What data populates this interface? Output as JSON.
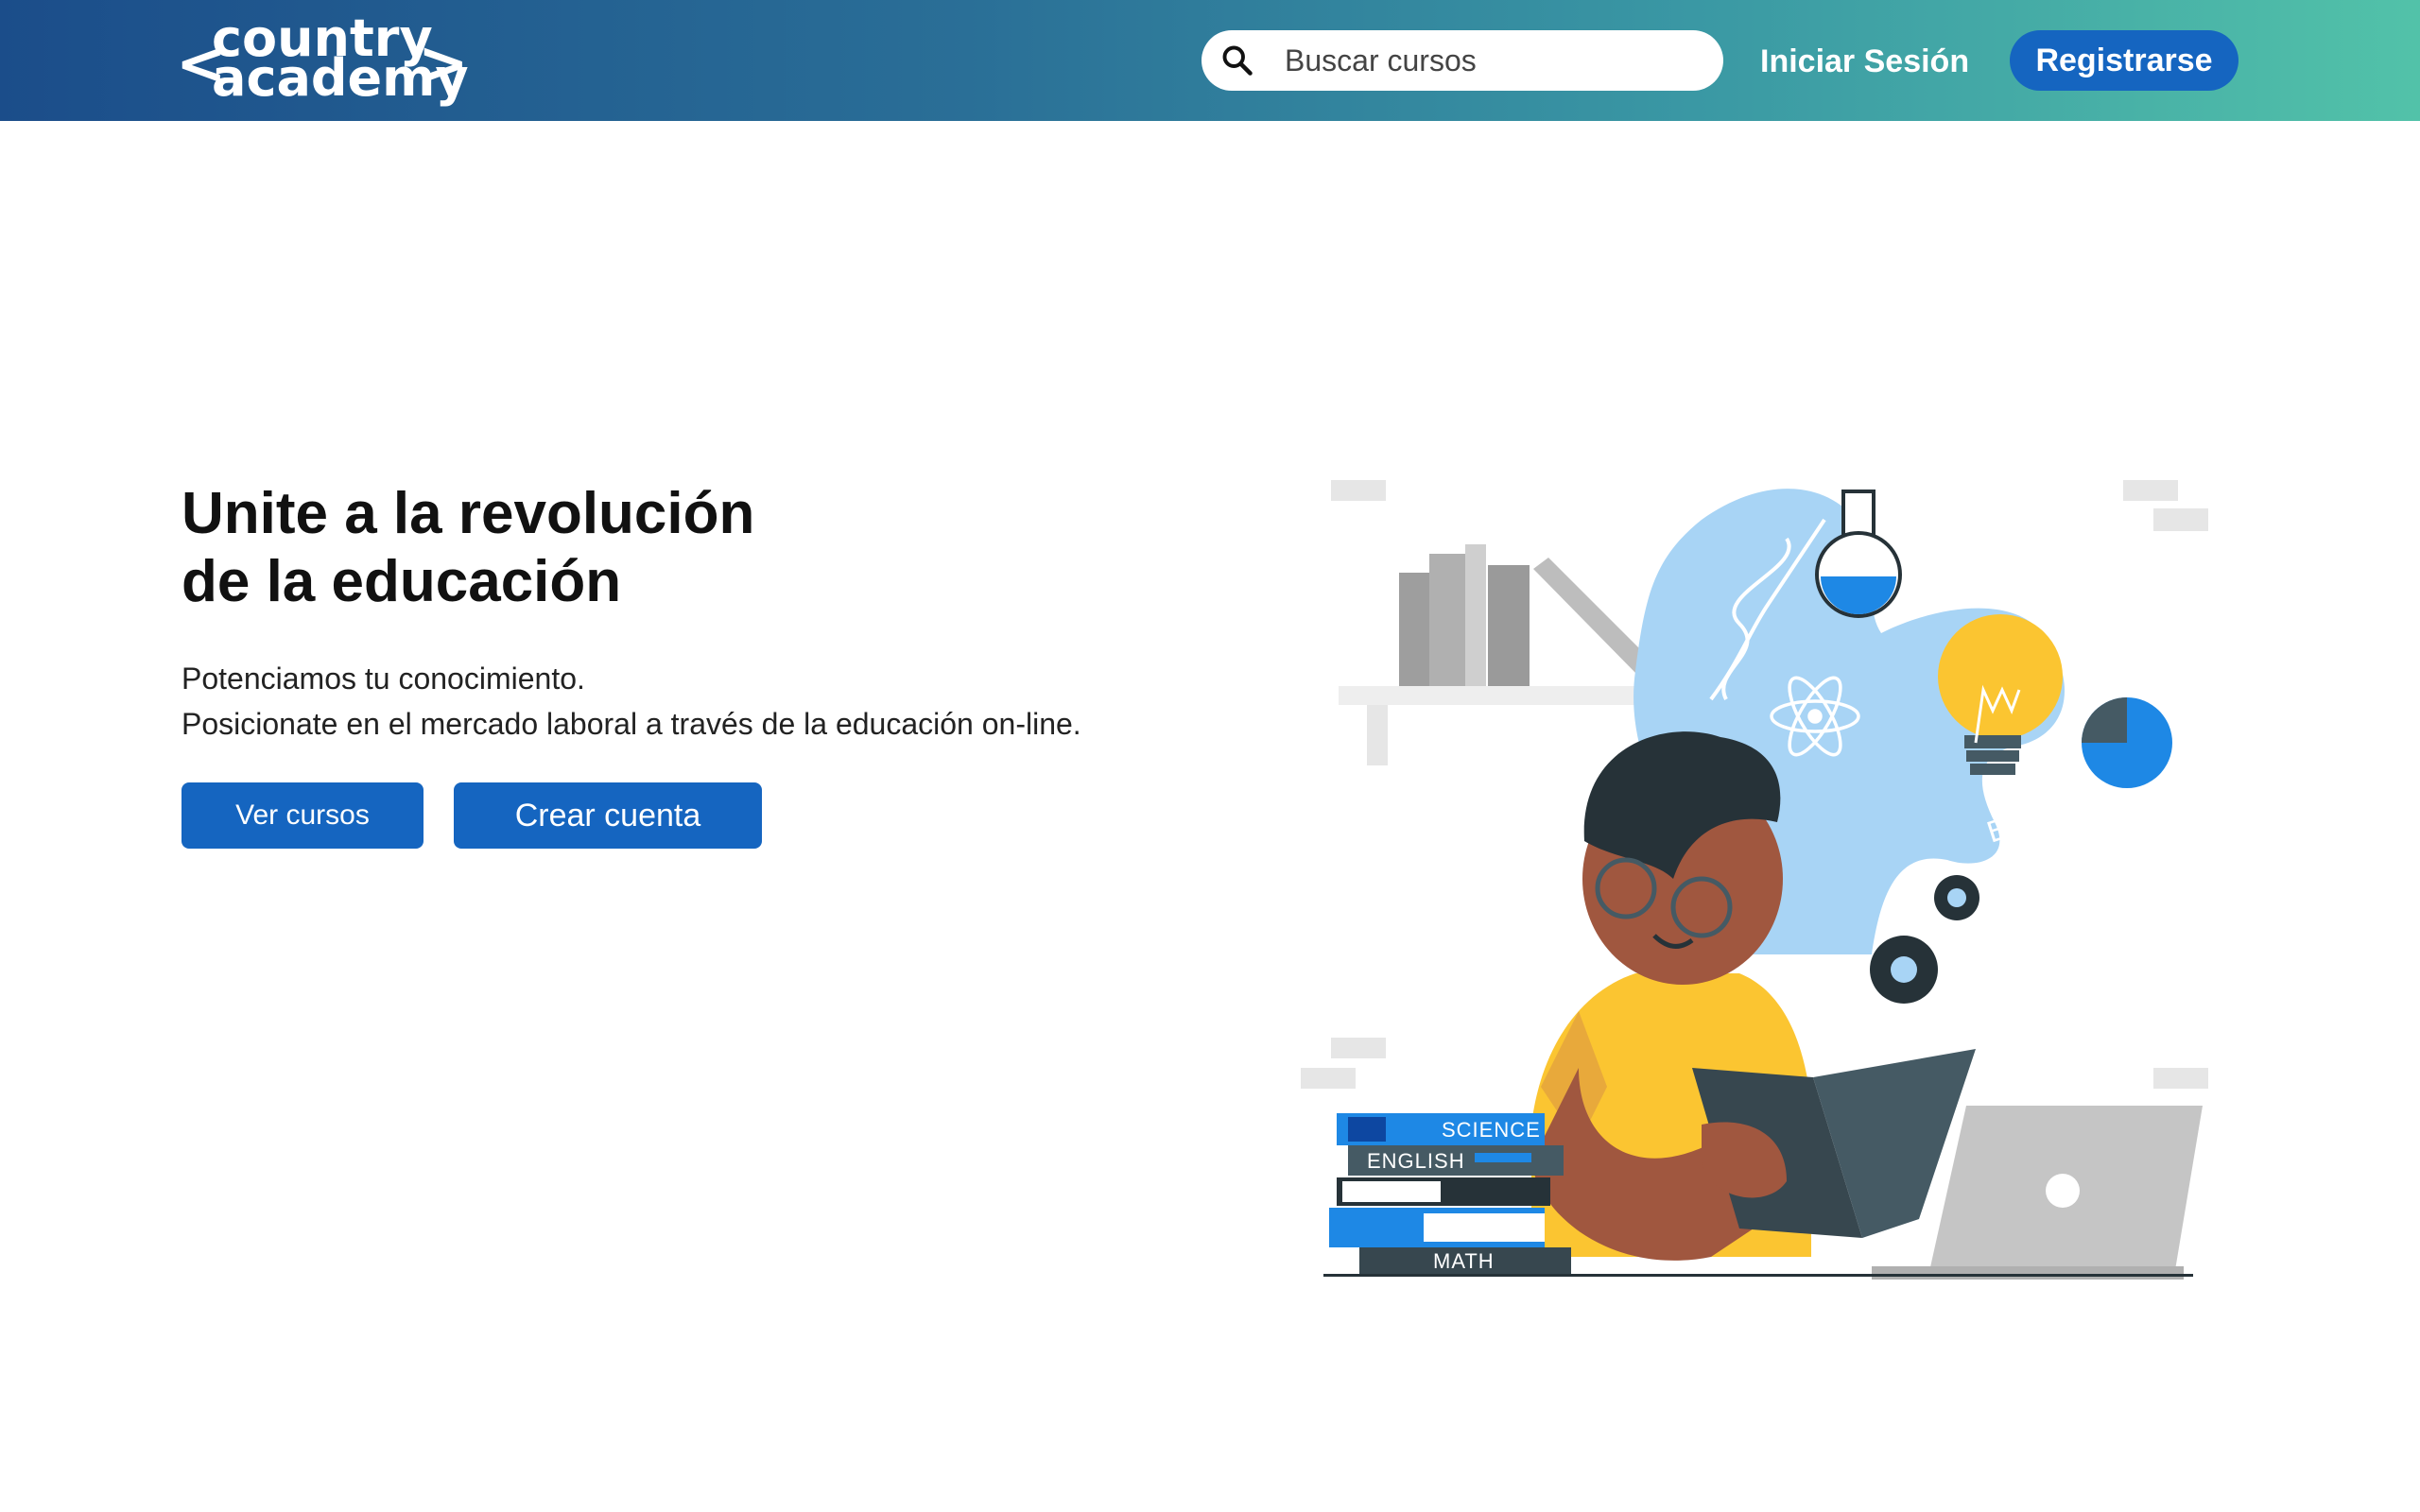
{
  "header": {
    "logo": {
      "line1": "country",
      "line2": "academy",
      "left_bracket": "<",
      "right_bracket": ">"
    },
    "search": {
      "placeholder": "Buscar cursos",
      "value": ""
    },
    "login_label": "Iniciar Sesión",
    "register_label": "Registrarse"
  },
  "hero": {
    "title_line1": "Unite a la revolución",
    "title_line2": "de la educación",
    "subtitle_line1": "Potenciamos tu conocimiento.",
    "subtitle_line2": "Posicionate en el mercado laboral a través de la educación on-line.",
    "button_courses": "Ver cursos",
    "button_create": "Crear cuenta"
  },
  "illustration": {
    "book_labels": [
      "SCIENCE",
      "ENGLISH",
      "MATH"
    ],
    "formula": "E = mc²"
  },
  "colors": {
    "header_gradient_start": "#1b4d8a",
    "header_gradient_end": "#52c2a9",
    "primary_button": "#1565c0",
    "shirt_yellow": "#fbc531",
    "bubble_blue": "#a8d4f5"
  }
}
